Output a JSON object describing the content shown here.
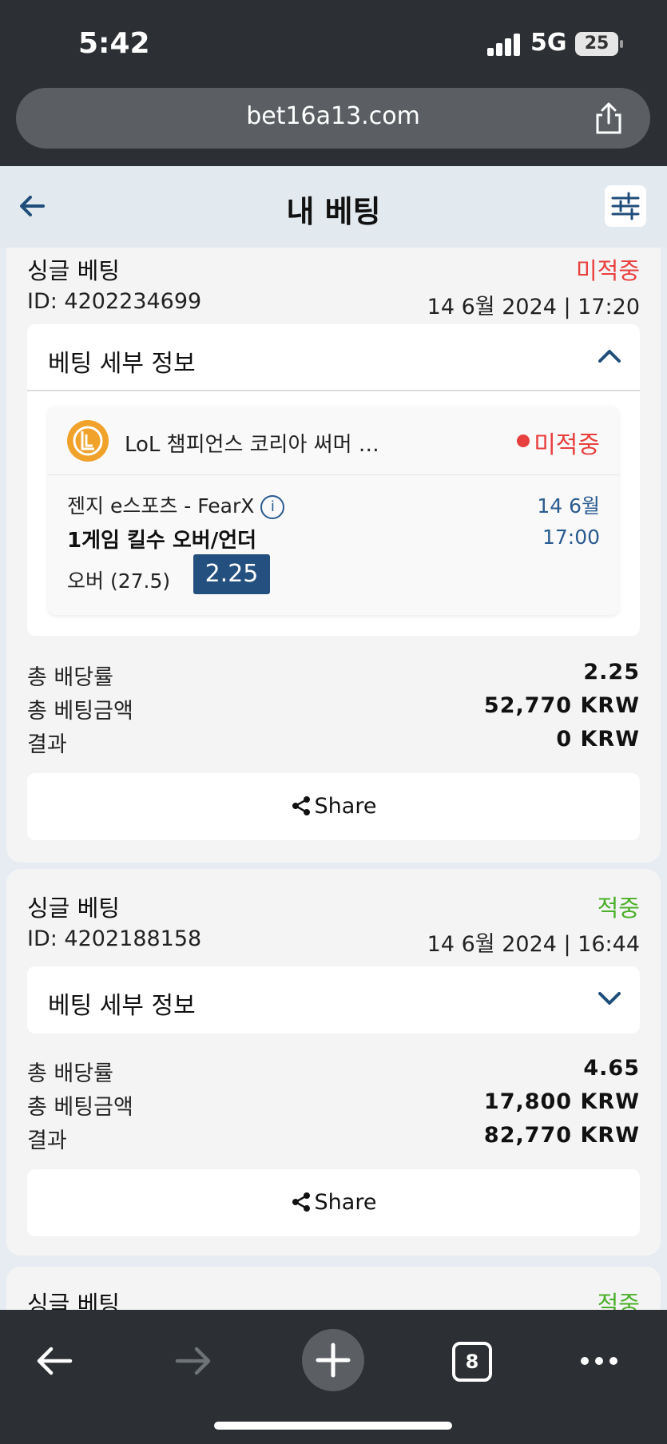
{
  "status_bar": {
    "time": "5:42",
    "network": "5G",
    "battery": "25"
  },
  "browser": {
    "url": "bet16a13.com"
  },
  "header": {
    "title": "내 베팅"
  },
  "bets": [
    {
      "type": "싱글 베팅",
      "status": "미적중",
      "id": "ID: 4202234699",
      "datetime": "14 6월 2024 | 17:20",
      "details_label": "베팅 세부 정보",
      "selection": {
        "league": "LoL 챔피언스 코리아 써머 …",
        "status": "미적중",
        "match": "젠지 e스포츠 - FearX",
        "date": "14 6월",
        "market": "1게임 킬수 오버/언더",
        "time": "17:00",
        "pick": "오버 (27.5)",
        "odds": "2.25"
      },
      "summary": [
        {
          "label": "총 배당률",
          "value": "2.25"
        },
        {
          "label": "총 베팅금액",
          "value": "52,770 KRW"
        },
        {
          "label": "결과",
          "value": "0 KRW"
        }
      ],
      "share_label": "Share"
    },
    {
      "type": "싱글 베팅",
      "status": "적중",
      "id": "ID: 4202188158",
      "datetime": "14 6월 2024 | 16:44",
      "details_label": "베팅 세부 정보",
      "summary": [
        {
          "label": "총 배당률",
          "value": "4.65"
        },
        {
          "label": "총 베팅금액",
          "value": "17,800 KRW"
        },
        {
          "label": "결과",
          "value": "82,770 KRW"
        }
      ],
      "share_label": "Share"
    },
    {
      "type": "싱글 베팅",
      "status": "적중"
    }
  ],
  "toolbar": {
    "tabs_count": "8"
  },
  "colors": {
    "lost": "#e8403e",
    "won": "#4caf29",
    "accent": "#24507f"
  }
}
